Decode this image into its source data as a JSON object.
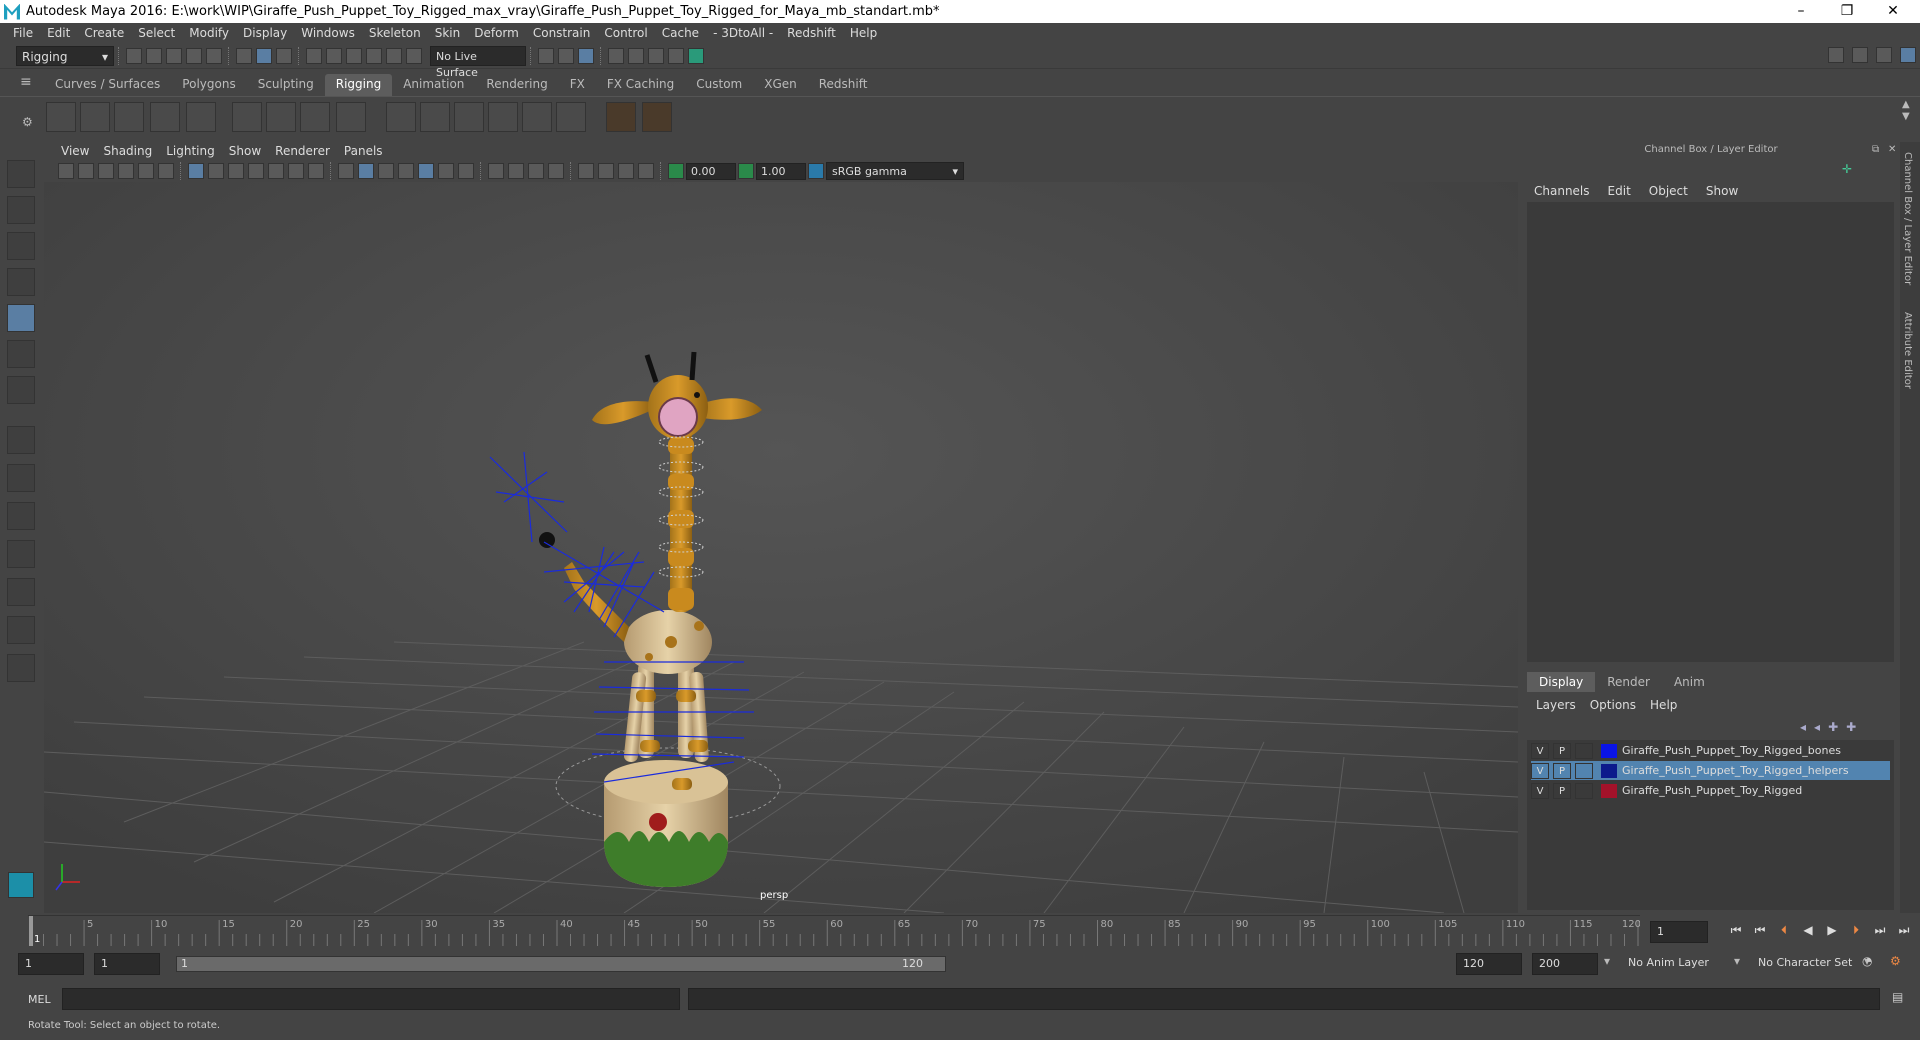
{
  "window": {
    "title": "Autodesk Maya 2016: E:\\work\\WIP\\Giraffe_Push_Puppet_Toy_Rigged_max_vray\\Giraffe_Push_Puppet_Toy_Rigged_for_Maya_mb_standart.mb*",
    "minimize": "–",
    "maximize": "❐",
    "close": "✕"
  },
  "menubar": [
    "File",
    "Edit",
    "Create",
    "Select",
    "Modify",
    "Display",
    "Windows",
    "Skeleton",
    "Skin",
    "Deform",
    "Constrain",
    "Control",
    "Cache",
    "- 3DtoAll -",
    "Redshift",
    "Help"
  ],
  "statusline": {
    "menuset": "Rigging",
    "live_surface": "No Live Surface"
  },
  "shelf_tabs": [
    "Curves / Surfaces",
    "Polygons",
    "Sculpting",
    "Rigging",
    "Animation",
    "Rendering",
    "FX",
    "FX Caching",
    "Custom",
    "XGen",
    "Redshift"
  ],
  "active_shelf": "Rigging",
  "viewport": {
    "menu": [
      "View",
      "Shading",
      "Lighting",
      "Show",
      "Renderer",
      "Panels"
    ],
    "exposure": "0.00",
    "gamma": "1.00",
    "color_space": "sRGB gamma",
    "camera_label": "persp"
  },
  "channel_box": {
    "title": "Channel Box / Layer Editor",
    "menu": [
      "Channels",
      "Edit",
      "Object",
      "Show"
    ]
  },
  "layer_editor": {
    "tabs": [
      "Display",
      "Render",
      "Anim"
    ],
    "active_tab": "Display",
    "menu": [
      "Layers",
      "Options",
      "Help"
    ],
    "layers": [
      {
        "v": "V",
        "p": "P",
        "color": "#0a14e6",
        "name": "Giraffe_Push_Puppet_Toy_Rigged_bones",
        "selected": false
      },
      {
        "v": "V",
        "p": "P",
        "color": "#0c1a8c",
        "name": "Giraffe_Push_Puppet_Toy_Rigged_helpers",
        "selected": true
      },
      {
        "v": "V",
        "p": "P",
        "color": "#a3122a",
        "name": "Giraffe_Push_Puppet_Toy_Rigged",
        "selected": false
      }
    ]
  },
  "side_tabs": [
    "Channel Box / Layer Editor",
    "Attribute Editor"
  ],
  "timeline": {
    "ticks": [
      "1",
      "5",
      "10",
      "15",
      "20",
      "25",
      "30",
      "35",
      "40",
      "45",
      "50",
      "55",
      "60",
      "65",
      "70",
      "75",
      "80",
      "85",
      "90",
      "95",
      "100",
      "105",
      "110",
      "115",
      "120"
    ],
    "current_frame": "1"
  },
  "range": {
    "start": "1",
    "playback_start": "1",
    "slider_start": "1",
    "slider_end": "120",
    "playback_end": "120",
    "end": "200",
    "anim_layer": "No Anim Layer",
    "character_set": "No Character Set"
  },
  "command_line": {
    "label": "MEL"
  },
  "help_line": "Rotate Tool: Select an object to rotate."
}
